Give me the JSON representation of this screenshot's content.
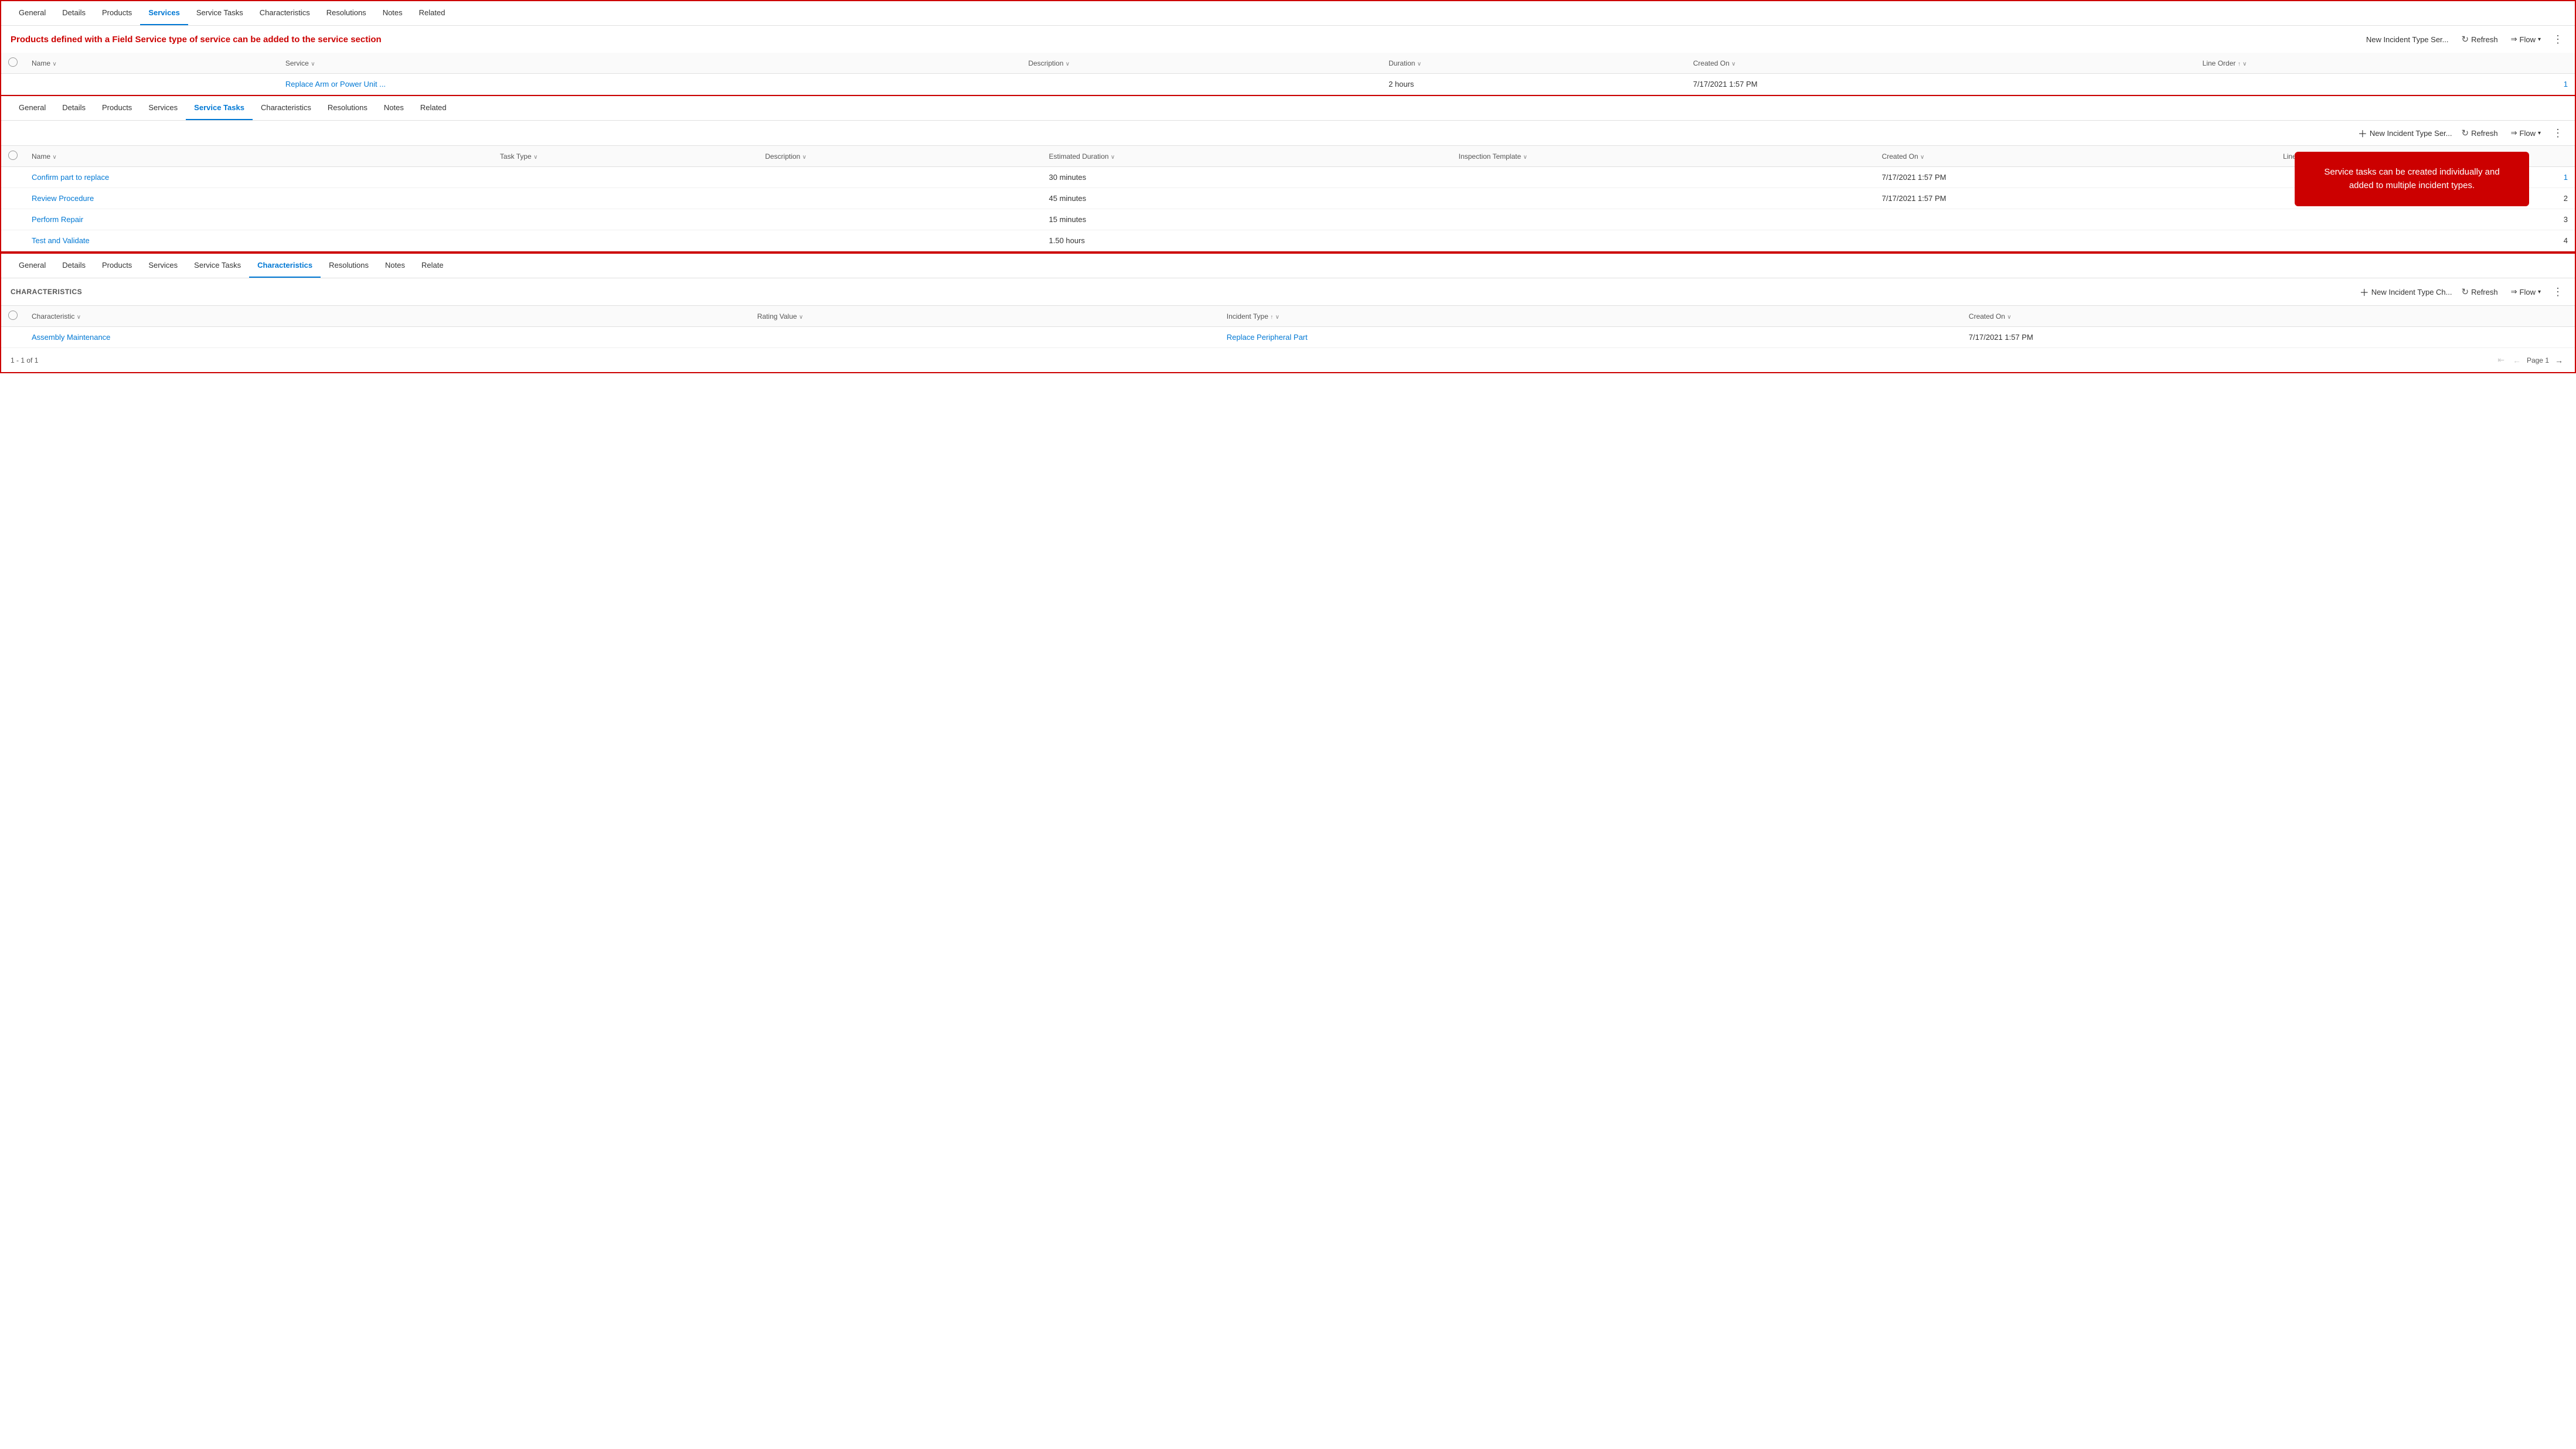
{
  "panel1": {
    "tabs": [
      {
        "label": "General",
        "active": false
      },
      {
        "label": "Details",
        "active": false
      },
      {
        "label": "Products",
        "active": false
      },
      {
        "label": "Services",
        "active": true
      },
      {
        "label": "Service Tasks",
        "active": false
      },
      {
        "label": "Characteristics",
        "active": false
      },
      {
        "label": "Resolutions",
        "active": false
      },
      {
        "label": "Notes",
        "active": false
      },
      {
        "label": "Related",
        "active": false
      }
    ],
    "banner": "Products defined with a Field Service type of service can be added to the service section",
    "toolbar": {
      "new_label": "New Incident Type Ser...",
      "refresh_label": "Refresh",
      "flow_label": "Flow"
    },
    "columns": [
      {
        "label": "Name",
        "sort": true
      },
      {
        "label": "Service",
        "sort": true
      },
      {
        "label": "Description",
        "sort": true
      },
      {
        "label": "Duration",
        "sort": true
      },
      {
        "label": "Created On",
        "sort": true
      },
      {
        "label": "Line Order",
        "sort": true,
        "asc": true
      }
    ],
    "rows": [
      {
        "name": "",
        "service": "Replace Arm or Power Unit ...",
        "description": "",
        "duration": "2 hours",
        "created_on": "7/17/2021 1:57 PM",
        "line_order": "1"
      }
    ]
  },
  "panel2": {
    "tabs": [
      {
        "label": "General",
        "active": false
      },
      {
        "label": "Details",
        "active": false
      },
      {
        "label": "Products",
        "active": false
      },
      {
        "label": "Services",
        "active": false
      },
      {
        "label": "Service Tasks",
        "active": true
      },
      {
        "label": "Characteristics",
        "active": false
      },
      {
        "label": "Resolutions",
        "active": false
      },
      {
        "label": "Notes",
        "active": false
      },
      {
        "label": "Related",
        "active": false
      }
    ],
    "toolbar": {
      "new_label": "New Incident Type Ser...",
      "refresh_label": "Refresh",
      "flow_label": "Flow"
    },
    "columns": [
      {
        "label": "Name",
        "sort": true
      },
      {
        "label": "Task Type",
        "sort": true
      },
      {
        "label": "Description",
        "sort": true
      },
      {
        "label": "Estimated Duration",
        "sort": true
      },
      {
        "label": "Inspection Template",
        "sort": true
      },
      {
        "label": "Created On",
        "sort": true
      },
      {
        "label": "Line Order",
        "sort": true,
        "asc": true
      }
    ],
    "rows": [
      {
        "name": "Confirm part to replace",
        "task_type": "",
        "description": "",
        "estimated_duration": "30 minutes",
        "inspection_template": "",
        "created_on": "7/17/2021 1:57 PM",
        "line_order": "1"
      },
      {
        "name": "Review Procedure",
        "task_type": "",
        "description": "",
        "estimated_duration": "45 minutes",
        "inspection_template": "",
        "created_on": "7/17/2021 1:57 PM",
        "line_order": "2"
      },
      {
        "name": "Perform Repair",
        "task_type": "",
        "description": "",
        "estimated_duration": "15 minutes",
        "inspection_template": "",
        "created_on": "",
        "line_order": "3"
      },
      {
        "name": "Test and Validate",
        "task_type": "",
        "description": "",
        "estimated_duration": "1.50 hours",
        "inspection_template": "",
        "created_on": "",
        "line_order": "4"
      }
    ],
    "tooltip": "Service tasks can be created individually\nand added to multiple incident types."
  },
  "panel3": {
    "tabs": [
      {
        "label": "General",
        "active": false
      },
      {
        "label": "Details",
        "active": false
      },
      {
        "label": "Products",
        "active": false
      },
      {
        "label": "Services",
        "active": false
      },
      {
        "label": "Service Tasks",
        "active": false
      },
      {
        "label": "Characteristics",
        "active": true
      },
      {
        "label": "Resolutions",
        "active": false
      },
      {
        "label": "Notes",
        "active": false
      },
      {
        "label": "Related",
        "active": false
      }
    ],
    "section_title": "CHARACTERISTICS",
    "toolbar": {
      "new_label": "New Incident Type Ch...",
      "refresh_label": "Refresh",
      "flow_label": "Flow"
    },
    "columns": [
      {
        "label": "Characteristic",
        "sort": true
      },
      {
        "label": "Rating Value",
        "sort": true
      },
      {
        "label": "Incident Type",
        "sort": true,
        "asc": true
      },
      {
        "label": "Created On",
        "sort": true
      }
    ],
    "rows": [
      {
        "characteristic": "Assembly Maintenance",
        "rating_value": "",
        "incident_type": "Replace Peripheral Part",
        "created_on": "7/17/2021 1:57 PM"
      }
    ],
    "pagination": {
      "summary": "1 - 1 of 1",
      "page_label": "Page 1"
    }
  }
}
